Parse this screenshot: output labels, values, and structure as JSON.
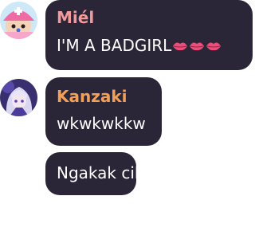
{
  "messages": [
    {
      "avatar": "chopper-avatar",
      "sender": "Miél",
      "sender_color": "#f29a9a",
      "text": "I'M A BADGIRL",
      "emoji": [
        "kiss-lips-icon",
        "kiss-lips-icon",
        "kiss-lips-icon"
      ]
    },
    {
      "avatar": "anime-girl-avatar",
      "sender": "Kanzaki",
      "sender_color": "#f2a058",
      "text": "wkwkwkkw"
    },
    {
      "text": "Ngakak cik"
    }
  ],
  "colors": {
    "bubble": "#2b2538",
    "message_text": "#ffffff"
  }
}
